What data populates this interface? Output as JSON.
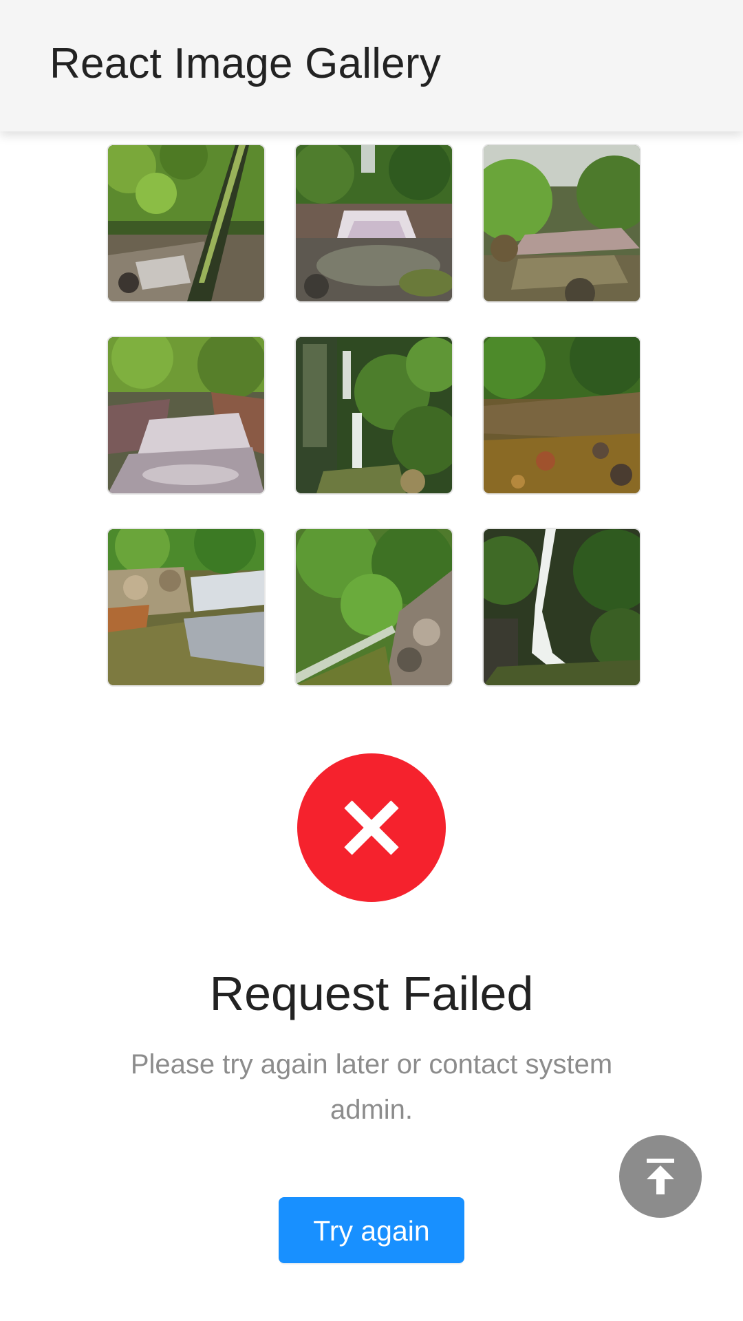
{
  "header": {
    "title": "React Image Gallery",
    "background": "#f5f5f5"
  },
  "gallery": {
    "images": [
      {
        "icon": "forest-stream-thumbnail-icon"
      },
      {
        "icon": "small-waterfall-thumbnail-icon"
      },
      {
        "icon": "river-bend-thumbnail-icon"
      },
      {
        "icon": "rocky-cascade-thumbnail-icon"
      },
      {
        "icon": "tall-waterfall-thumbnail-icon"
      },
      {
        "icon": "mossy-creek-thumbnail-icon"
      },
      {
        "icon": "stepped-falls-thumbnail-icon"
      },
      {
        "icon": "jungle-slope-thumbnail-icon"
      },
      {
        "icon": "gorge-waterfall-thumbnail-icon"
      }
    ]
  },
  "error": {
    "icon": "close-icon",
    "icon_color": "#f5222d",
    "title": "Request Failed",
    "subtitle": "Please try again later or contact system admin.",
    "retry_label": "Try again",
    "retry_color": "#1890ff"
  },
  "back_to_top": {
    "icon": "arrow-up-to-line-icon",
    "color": "#8c8c8c"
  }
}
